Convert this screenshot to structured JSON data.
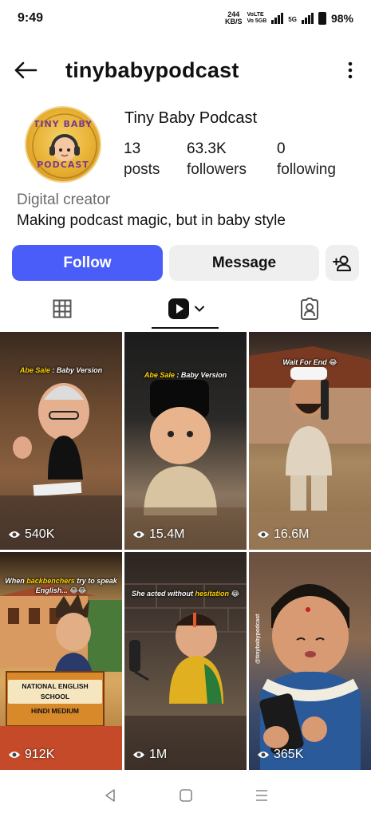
{
  "status_bar": {
    "time": "9:49",
    "net_speed_value": "244",
    "net_speed_unit": "KB/S",
    "volte_top": "VoLTE",
    "volte_bottom": "Vo 5GB",
    "network": "5G",
    "battery": "98%"
  },
  "header": {
    "username": "tinybabypodcast"
  },
  "profile": {
    "avatar_text_top": "TINY BABY",
    "avatar_text_bottom": "PODCAST",
    "display_name": "Tiny Baby Podcast",
    "stats": [
      {
        "value": "13",
        "label": "posts"
      },
      {
        "value": "63.3K",
        "label": "followers"
      },
      {
        "value": "0",
        "label": "following"
      }
    ],
    "category": "Digital creator",
    "bio": "Making podcast magic, but in baby style"
  },
  "actions": {
    "follow_label": "Follow",
    "message_label": "Message"
  },
  "posts": [
    {
      "caption_hl": "Abe Sale",
      "caption": " : Baby Version",
      "views": "540K"
    },
    {
      "caption_hl": "Abe Sale",
      "caption": " : Baby Version",
      "views": "15.4M"
    },
    {
      "caption_hl": "",
      "caption": "Wait For End 😂",
      "views": "16.6M"
    },
    {
      "caption_pre": "When ",
      "caption_hl": "backbenchers",
      "caption": " try to speak English... 😂😂",
      "sign_line1": "NATIONAL ENGLISH SCHOOL",
      "sign_line2": "HINDI MEDIUM",
      "views": "912K"
    },
    {
      "caption_pre": "She acted without ",
      "caption_hl": "hesitation",
      "caption": " 😂",
      "views": "1M"
    },
    {
      "side_text": "@tinybabypodcast",
      "views": "365K"
    }
  ],
  "colors": {
    "follow_button": "#4a5df9",
    "secondary_button": "#efefef",
    "caption_highlight": "#ffd400"
  }
}
